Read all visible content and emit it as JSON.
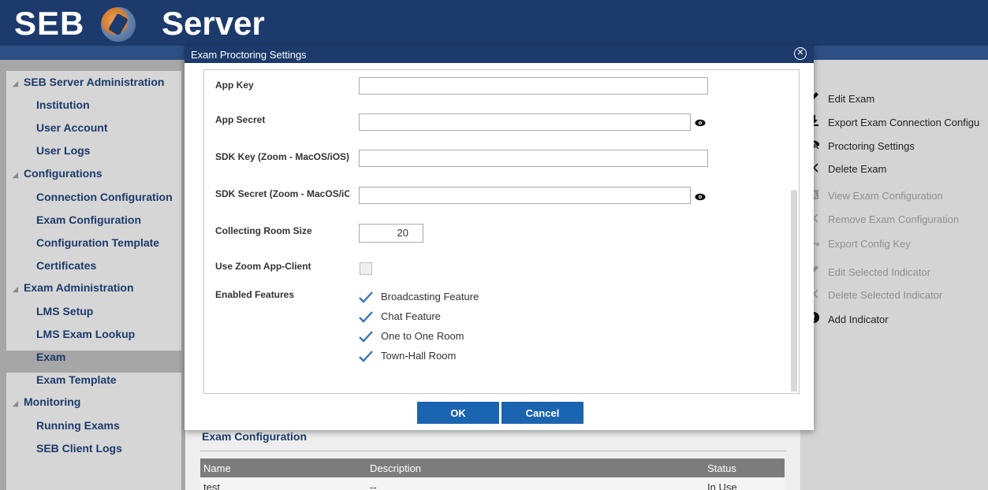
{
  "header": {
    "logo_left": "SEB",
    "logo_right": "Server"
  },
  "sidebar": {
    "items": [
      {
        "label": "SEB Server Administration",
        "type": "section"
      },
      {
        "label": "Institution",
        "type": "sub"
      },
      {
        "label": "User Account",
        "type": "sub"
      },
      {
        "label": "User Logs",
        "type": "sub"
      },
      {
        "label": "Configurations",
        "type": "section"
      },
      {
        "label": "Connection Configuration",
        "type": "sub"
      },
      {
        "label": "Exam Configuration",
        "type": "sub"
      },
      {
        "label": "Configuration Template",
        "type": "sub"
      },
      {
        "label": "Certificates",
        "type": "sub"
      },
      {
        "label": "Exam Administration",
        "type": "section"
      },
      {
        "label": "LMS Setup",
        "type": "sub"
      },
      {
        "label": "LMS Exam Lookup",
        "type": "sub"
      },
      {
        "label": "Exam",
        "type": "sub",
        "active": true
      },
      {
        "label": "Exam Template",
        "type": "sub"
      },
      {
        "label": "Monitoring",
        "type": "section"
      },
      {
        "label": "Running Exams",
        "type": "sub"
      },
      {
        "label": "SEB Client Logs",
        "type": "sub"
      }
    ]
  },
  "actions": [
    {
      "label": "Edit Exam",
      "icon": "pencil-icon",
      "enabled": true
    },
    {
      "label": "Export Exam Connection Configu",
      "icon": "download-icon",
      "enabled": true
    },
    {
      "label": "Proctoring Settings",
      "icon": "eye-slash-icon",
      "enabled": true
    },
    {
      "label": "Delete Exam",
      "icon": "close-icon",
      "enabled": true
    },
    {
      "label": "View Exam Configuration",
      "icon": "view-icon",
      "enabled": false
    },
    {
      "label": "Remove Exam Configuration",
      "icon": "close-icon",
      "enabled": false
    },
    {
      "label": "Export Config Key",
      "icon": "key-icon",
      "enabled": false
    },
    {
      "label": "Edit Selected Indicator",
      "icon": "pencil-icon",
      "enabled": false
    },
    {
      "label": "Delete Selected Indicator",
      "icon": "close-icon",
      "enabled": false
    },
    {
      "label": "Add Indicator",
      "icon": "exclamation-icon",
      "enabled": true
    }
  ],
  "main": {
    "section_title": "Exam Configuration",
    "table": {
      "columns": [
        "Name",
        "Description",
        "Status"
      ],
      "rows": [
        [
          "test",
          "--",
          "In Use"
        ]
      ]
    }
  },
  "dialog": {
    "title": "Exam Proctoring Settings",
    "fields": {
      "app_key_label": "App Key",
      "app_key_value": "",
      "app_secret_label": "App Secret",
      "app_secret_value": "",
      "sdk_key_label": "SDK Key (Zoom - MacOS/iOS)",
      "sdk_key_value": "",
      "sdk_secret_label": "SDK Secret (Zoom - MacOS/iC",
      "sdk_secret_value": "",
      "room_size_label": "Collecting Room Size",
      "room_size_value": "20",
      "zoom_client_label": "Use Zoom App-Client",
      "zoom_client_checked": false,
      "features_label": "Enabled Features"
    },
    "features": [
      {
        "label": "Broadcasting Feature",
        "checked": true
      },
      {
        "label": "Chat Feature",
        "checked": true
      },
      {
        "label": "One to One Room",
        "checked": true
      },
      {
        "label": "Town-Hall Room",
        "checked": true
      }
    ],
    "ok_label": "OK",
    "cancel_label": "Cancel"
  },
  "colors": {
    "brand": "#1c3a6b",
    "button": "#1b64b0"
  }
}
